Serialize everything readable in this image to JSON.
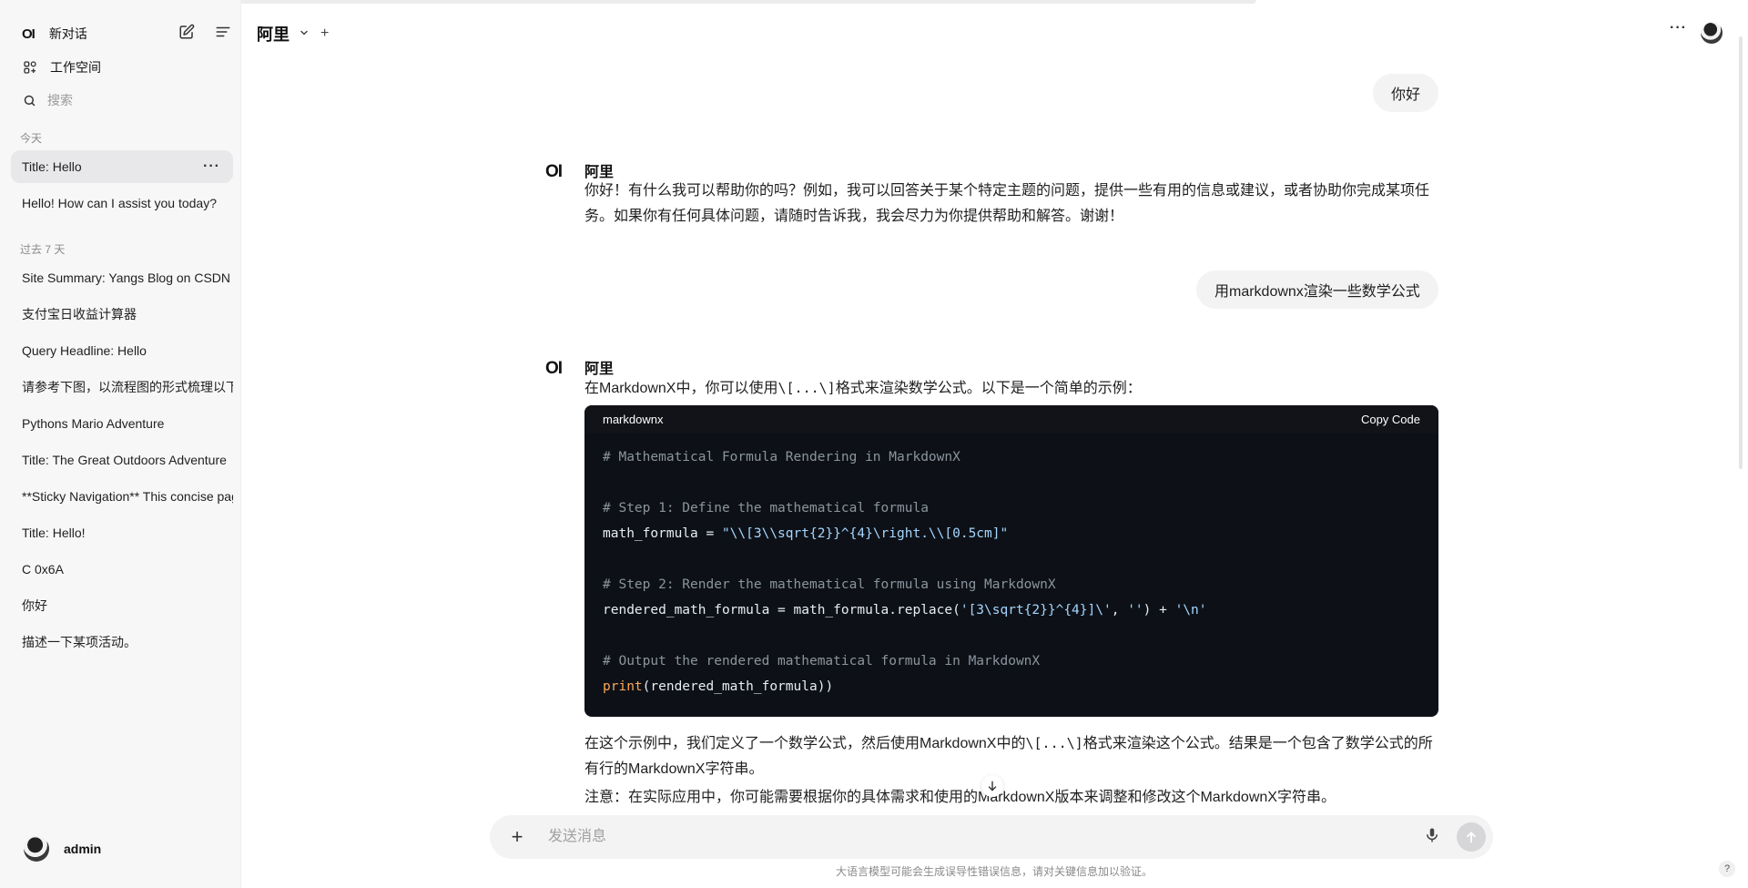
{
  "sidebar": {
    "logo": "OI",
    "new_chat": "新对话",
    "workspace": "工作空间",
    "search_placeholder": "搜索",
    "sections": [
      {
        "label": "今天",
        "items": [
          "Title: Hello",
          "Hello! How can I assist you today?"
        ]
      },
      {
        "label": "过去 7 天",
        "items": [
          "Site Summary: Yangs Blog on CSDN",
          "支付宝日收益计算器",
          "Query Headline: Hello",
          "请参考下图，以流程图的形式梳理以下内容",
          "Pythons Mario Adventure",
          "Title: The Great Outdoors Adventure",
          "**Sticky Navigation** This concise page",
          "Title: Hello!",
          "C 0x6A",
          "你好",
          "描述一下某项活动。"
        ]
      }
    ],
    "active_item": "Title: Hello",
    "more_label": "···",
    "user_name": "admin"
  },
  "header": {
    "model_name": "阿里",
    "chevron": "⌄",
    "plus": "+",
    "more": "···"
  },
  "messages": [
    {
      "role": "user",
      "text": "你好"
    },
    {
      "role": "assistant",
      "name": "阿里",
      "logo": "OI",
      "line1": "你好！有什么我可以帮助你的吗？例如，我可以回答关于某个特定主题的问题，提供一些有用的信息或建议，或者协助你完成某项任",
      "line2": "务。如果你有任何具体问题，请随时告诉我，我会尽力为你提供帮助和解答。谢谢！"
    },
    {
      "role": "user",
      "text": "用markdownx渲染一些数学公式"
    },
    {
      "role": "assistant",
      "name": "阿里",
      "logo": "OI",
      "intro_a": "在MarkdownX中，你可以使用",
      "intro_code": "\\[...\\]",
      "intro_b": "格式来渲染数学公式。以下是一个简单的示例：",
      "after1_a": "在这个示例中，我们定义了一个数学公式，然后使用MarkdownX中的",
      "after1_code": "\\[...\\]",
      "after1_b": "格式来渲染这个公式。结果是一个包含了数学公式的所",
      "after1_line2": "有行的MarkdownX字符串。",
      "after2": "注意：在实际应用中，你可能需要根据你的具体需求和使用的MarkdownX版本来调整和修改这个MarkdownX字符串。"
    }
  ],
  "code": {
    "language": "markdownx",
    "copy_label": "Copy Code",
    "l1": "# Mathematical Formula Rendering in MarkdownX",
    "l3": "# Step 1: Define the mathematical formula",
    "l4a": "math_formula = ",
    "l4b": "\"\\\\[3\\\\sqrt{2}}^{4}\\right.\\\\[0.5cm]\"",
    "l6": "# Step 2: Render the mathematical formula using MarkdownX",
    "l7a": "rendered_math_formula = math_formula.replace(",
    "l7b": "'[3\\sqrt{2}}^{4}]\\'",
    "l7c": ", ",
    "l7d": "''",
    "l7e": ") + ",
    "l7f": "'\\n'",
    "l9": "# Output the rendered mathematical formula in MarkdownX",
    "l10a": "print",
    "l10b": "(rendered_math_formula))"
  },
  "composer": {
    "placeholder": "发送消息",
    "plus": "+"
  },
  "disclaimer": "大语言模型可能会生成误导性错误信息，请对关键信息加以验证。",
  "help": "?"
}
